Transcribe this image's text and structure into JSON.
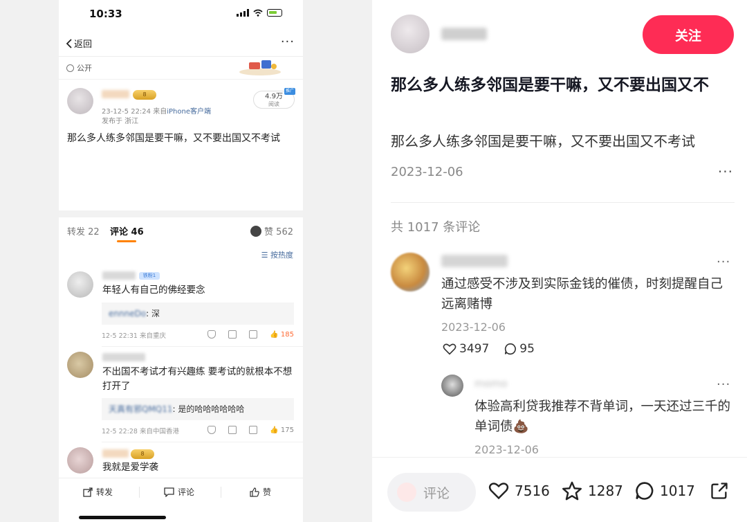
{
  "left": {
    "status_time": "10:33",
    "back_label": "返回",
    "more": "···",
    "visibility": "公开",
    "post": {
      "time": "23-12-5 22:24",
      "source_prefix": "来自",
      "source": "iPhone客户端",
      "location": "发布于 浙江",
      "reads_count": "4.9万",
      "reads_label": "阅读",
      "promo_badge": "推广",
      "vip_badge": "8",
      "text": "那么多人练多邻国是要干嘛，又不要出国又不考试"
    },
    "tabs": {
      "repost": "转发 22",
      "comment": "评论 46",
      "like": "赞 562"
    },
    "sort_label": "按热度",
    "comments": [
      {
        "fan_badge": "铁粉1",
        "text": "年轻人有自己的佛经要念",
        "reply_name": "ennneDo",
        "reply_text": ": 深",
        "meta": "12-5 22:31 来自重庆",
        "likes": "185"
      },
      {
        "text": "不出国不考试才有兴趣练 要考试的就根本不想打开了",
        "reply_name": "天真有邪QMQ11",
        "reply_text": ": 是的哈哈哈哈哈哈",
        "meta": "12-5 22:28 来自中国香港",
        "likes": "175"
      },
      {
        "vip_badge": "8",
        "text": "我就是爱学袭"
      }
    ],
    "bottom": {
      "repost": "转发",
      "comment": "评论",
      "like": "赞"
    }
  },
  "right": {
    "follow_label": "关注",
    "title": "那么多人练多邻国是要干嘛，又不要出国又不",
    "body": "那么多人练多邻国是要干嘛，又不要出国又不考试",
    "date": "2023-12-06",
    "comment_count": "共 1017 条评论",
    "comments": [
      {
        "text": "通过感受不涉及到实际金钱的催债，时刻提醒自己远离赌博",
        "date": "2023-12-06",
        "likes": "3497",
        "replies": "95"
      },
      {
        "name": "momo",
        "text": "体验高利贷我推荐不背单词，一天还过三千的单词债💩",
        "date": "2023-12-06"
      }
    ],
    "bottom": {
      "input_placeholder": "评论",
      "likes": "7516",
      "favorites": "1287",
      "comments": "1017"
    }
  },
  "colors": {
    "follow_red": "#fe2c55",
    "weibo_orange": "#ff8200",
    "link_blue": "#456a9c"
  },
  "icons": [
    "signal-icon",
    "wifi-icon",
    "battery-icon",
    "chevron-left-icon",
    "globe-icon",
    "heart-icon",
    "star-icon",
    "comment-bubble-icon",
    "share-icon",
    "thumb-up-icon",
    "repost-icon",
    "shield-icon"
  ]
}
